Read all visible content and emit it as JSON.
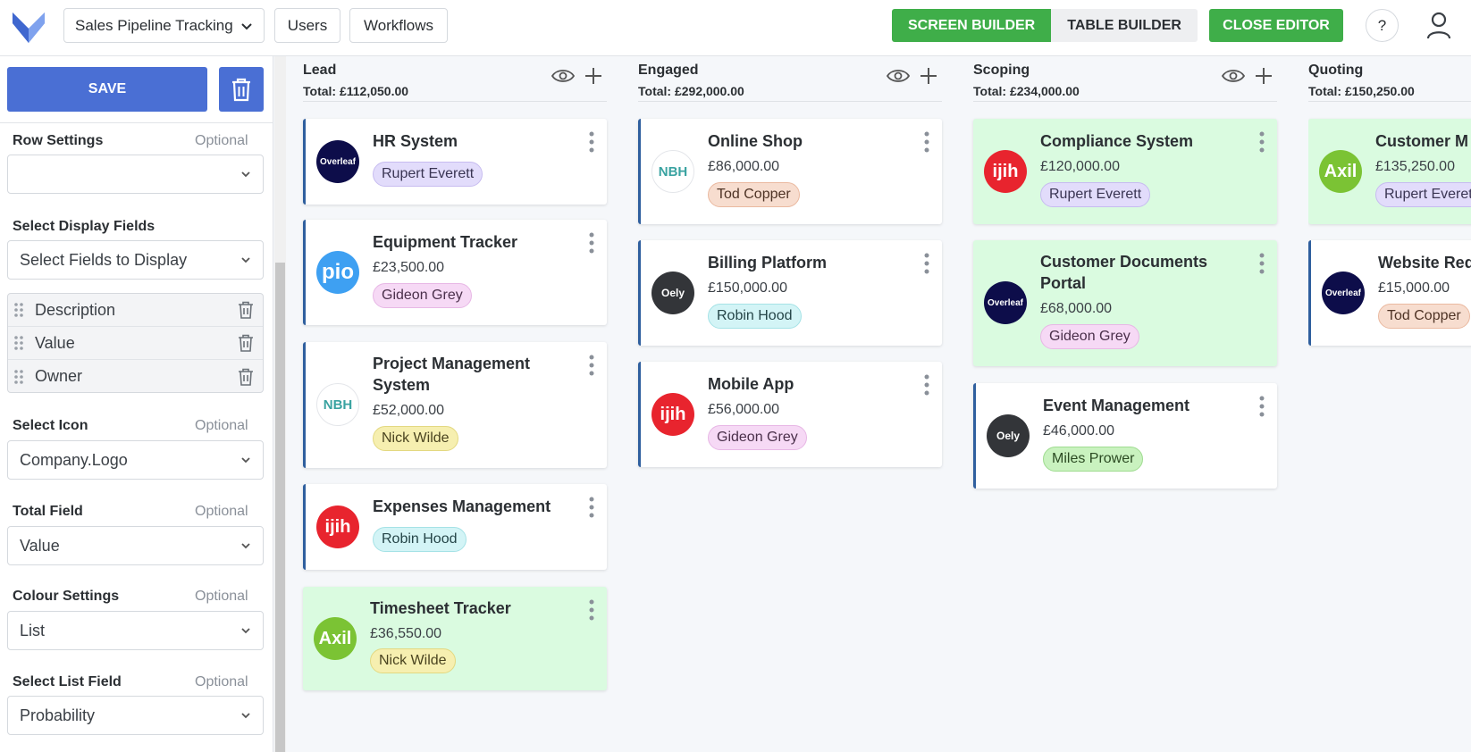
{
  "header": {
    "pipeline_select": "Sales Pipeline Tracking",
    "users_label": "Users",
    "workflows_label": "Workflows",
    "screen_builder_label": "SCREEN BUILDER",
    "table_builder_label": "TABLE BUILDER",
    "close_editor_label": "CLOSE EDITOR",
    "help_label": "?"
  },
  "sidebar": {
    "save_label": "SAVE",
    "row_settings": {
      "label": "Row Settings",
      "optional": "Optional",
      "value": ""
    },
    "display_fields": {
      "label": "Select Display Fields",
      "placeholder": "Select Fields to Display",
      "items": [
        "Description",
        "Value",
        "Owner"
      ]
    },
    "select_icon": {
      "label": "Select Icon",
      "optional": "Optional",
      "value": "Company.Logo"
    },
    "total_field": {
      "label": "Total Field",
      "optional": "Optional",
      "value": "Value"
    },
    "colour_settings": {
      "label": "Colour Settings",
      "optional": "Optional",
      "value": "List"
    },
    "list_field": {
      "label": "Select List Field",
      "optional": "Optional",
      "value": "Probability"
    }
  },
  "columns": [
    {
      "title": "Lead",
      "total": "Total: £112,050.00",
      "cards": [
        {
          "title": "HR System",
          "value": "",
          "owner": "Rupert Everett",
          "logo": "Overleaf"
        },
        {
          "title": "Equipment Tracker",
          "value": "£23,500.00",
          "owner": "Gideon Grey",
          "logo": "pio"
        },
        {
          "title_1": "Project Management",
          "title_2": "System",
          "value": "£52,000.00",
          "owner": "Nick Wilde",
          "logo": "NBH"
        },
        {
          "title": "Expenses Management",
          "value": "",
          "owner": "Robin Hood",
          "logo": "ijih"
        },
        {
          "title": "Timesheet Tracker",
          "value": "£36,550.00",
          "owner": "Nick Wilde",
          "logo": "Axil"
        }
      ]
    },
    {
      "title": "Engaged",
      "total": "Total: £292,000.00",
      "cards": [
        {
          "title": "Online Shop",
          "value": "£86,000.00",
          "owner": "Tod Copper",
          "logo": "NBH"
        },
        {
          "title": "Billing Platform",
          "value": "£150,000.00",
          "owner": "Robin Hood",
          "logo": "Oely"
        },
        {
          "title": "Mobile App",
          "value": "£56,000.00",
          "owner": "Gideon Grey",
          "logo": "ijih"
        }
      ]
    },
    {
      "title": "Scoping",
      "total": "Total: £234,000.00",
      "cards": [
        {
          "title": "Compliance System",
          "value": "£120,000.00",
          "owner": "Rupert Everett",
          "logo": "ijih"
        },
        {
          "title_1": "Customer Documents",
          "title_2": "Portal",
          "value": "£68,000.00",
          "owner": "Gideon Grey",
          "logo": "Overleaf"
        },
        {
          "title": "Event Management",
          "value": "£46,000.00",
          "owner": "Miles Prower",
          "logo": "Oely"
        }
      ]
    },
    {
      "title": "Quoting",
      "total": "Total: £150,250.00",
      "cards": [
        {
          "title": "Customer M",
          "value": "£135,250.00",
          "owner": "Rupert Everet",
          "logo": "Axil"
        },
        {
          "title": "Website Red",
          "value": "£15,000.00",
          "owner": "Tod Copper",
          "logo": "Overleaf"
        }
      ]
    }
  ],
  "colors": {
    "green": "#3fae49",
    "blue": "#4a6fd4",
    "card_green": "#dafbe0",
    "accent_border": "#2f5f9e"
  }
}
